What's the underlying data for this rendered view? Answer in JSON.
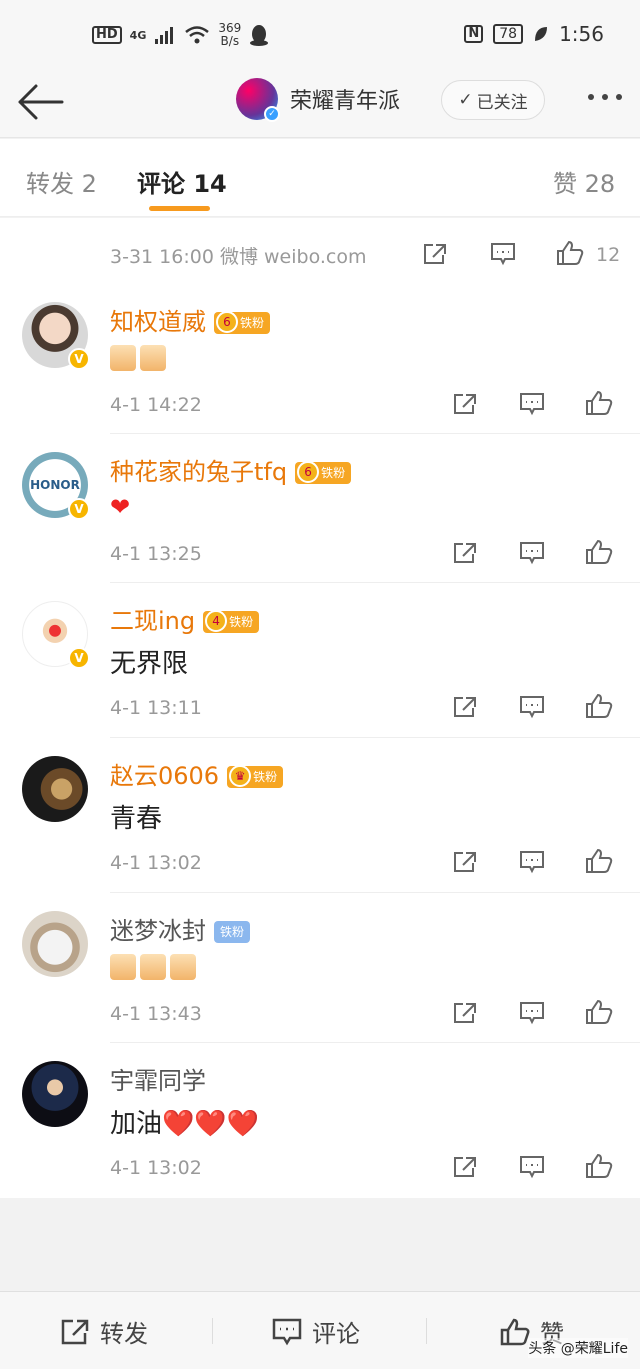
{
  "status_bar": {
    "hd": "HD",
    "network": "4G",
    "speed_value": "369",
    "speed_unit": "B/s",
    "nfc": "N",
    "battery": "78",
    "time": "1:56"
  },
  "nav": {
    "account_name": "荣耀青年派",
    "follow_label": "已关注"
  },
  "tabs": [
    {
      "label": "转发 2"
    },
    {
      "label": "评论 14"
    },
    {
      "label": "赞 28"
    }
  ],
  "post_meta": {
    "text": "3-31 16:00  微博 weibo.com",
    "like_count": "12"
  },
  "comments": [
    {
      "user": "知权道威",
      "badge": "铁粉",
      "badge_level": "6",
      "content": "",
      "thumbs": 2,
      "time": "4-1 14:22"
    },
    {
      "user": "种花家的兔子tfq",
      "badge": "铁粉",
      "badge_level": "6",
      "content": "",
      "hearts": 1,
      "time": "4-1 13:25",
      "avatar_text": "HONOR"
    },
    {
      "user": "二现ing",
      "badge": "铁粉",
      "badge_level": "4",
      "content": "无界限",
      "time": "4-1 13:11"
    },
    {
      "user": "赵云0606",
      "badge": "铁粉",
      "badge_level": "",
      "content": "青春",
      "time": "4-1 13:02"
    },
    {
      "user": "迷梦冰封",
      "badge": "铁粉",
      "content": "",
      "thumbs": 3,
      "time": "4-1 13:43"
    },
    {
      "user": "宇霏同学",
      "content": "加油❤️❤️❤️",
      "time": "4-1 13:02"
    }
  ],
  "bottom_bar": {
    "repost": "转发",
    "comment": "评论",
    "like": "赞"
  },
  "watermark": "头条 @荣耀Life"
}
